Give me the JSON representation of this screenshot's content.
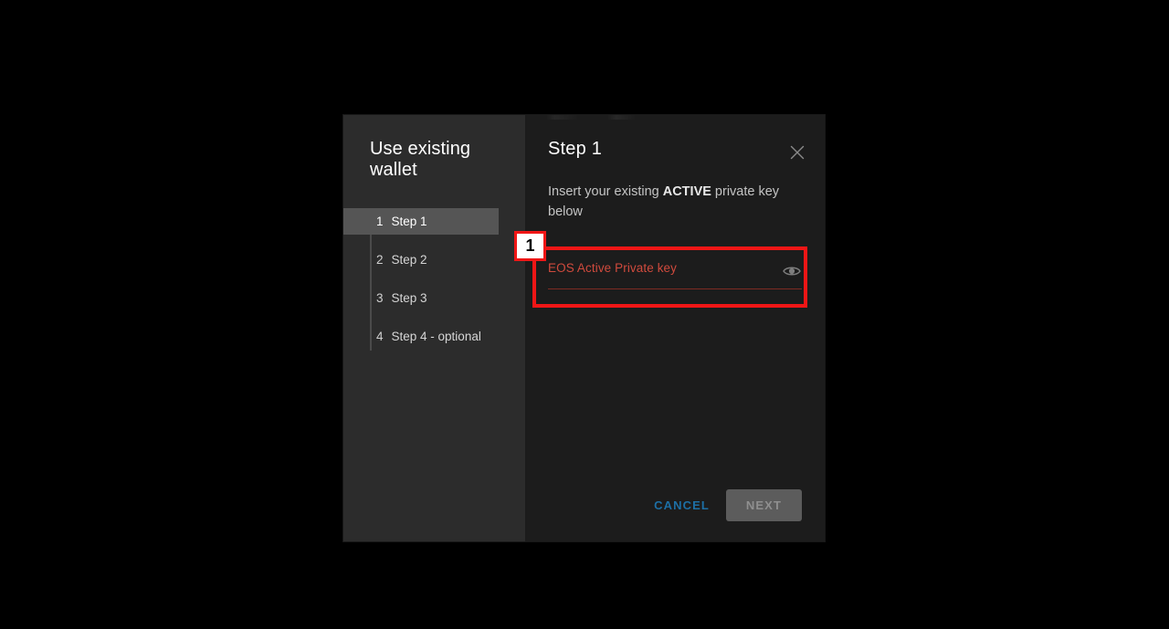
{
  "dialog": {
    "sidebar": {
      "title": "Use existing wallet",
      "steps": [
        {
          "num": "1",
          "label": "Step 1",
          "active": true
        },
        {
          "num": "2",
          "label": "Step 2",
          "active": false
        },
        {
          "num": "3",
          "label": "Step 3",
          "active": false
        },
        {
          "num": "4",
          "label": "Step 4 - optional",
          "active": false
        }
      ]
    },
    "panel": {
      "title": "Step 1",
      "close_icon": "close-icon",
      "description_before": "Insert your existing ",
      "description_strong": "ACTIVE",
      "description_after": " private key below",
      "field": {
        "label": "EOS Active Private key",
        "value": "",
        "placeholder": "EOS Active Private key",
        "state": "error",
        "reveal_icon": "eye-icon"
      },
      "actions": {
        "cancel_label": "CANCEL",
        "next_label": "NEXT",
        "next_disabled": true
      }
    }
  },
  "annotation": {
    "badge_number": "1"
  },
  "colors": {
    "backdrop": "#000000",
    "dialog_bg": "#1c1c1c",
    "sidebar_bg": "#2c2c2c",
    "active_step_bg": "#555555",
    "error_red": "#d04a3d",
    "annotation_red": "#f01616",
    "cancel_blue": "#1d6fa5",
    "next_disabled_bg": "#5c5c5c"
  }
}
